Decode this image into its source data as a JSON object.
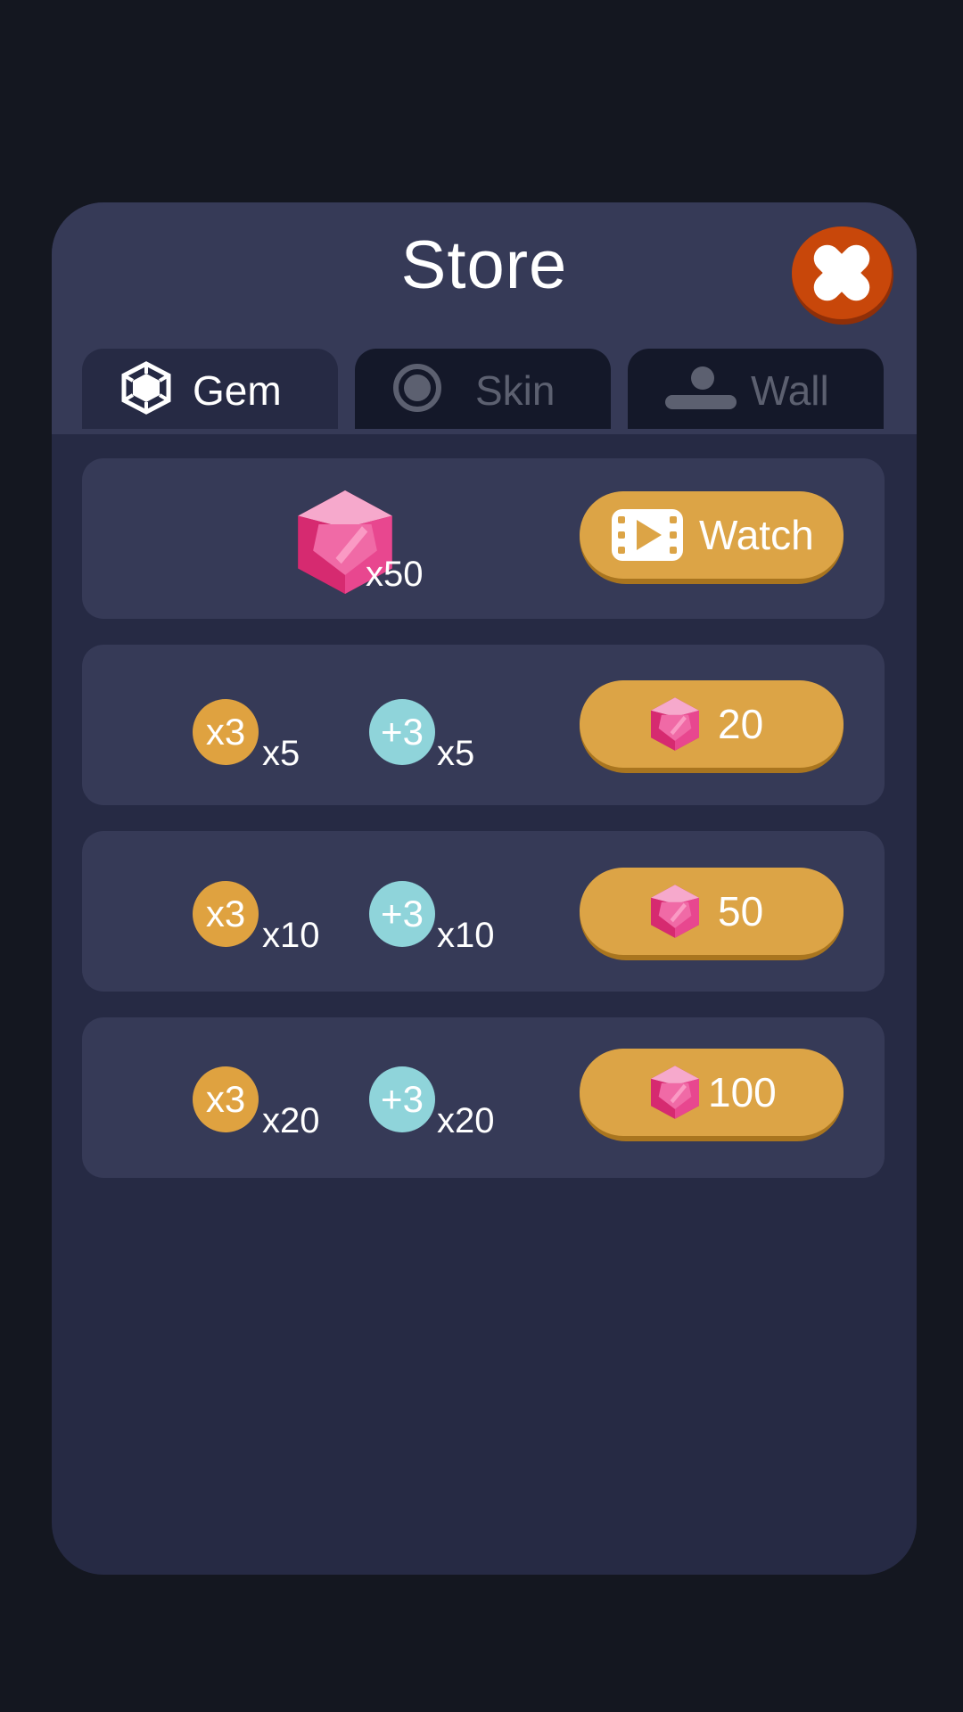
{
  "store": {
    "title": "Store",
    "tabs": [
      {
        "label": "Gem",
        "icon": "hexagon-gem-icon",
        "active": true
      },
      {
        "label": "Skin",
        "icon": "ring-icon",
        "active": false
      },
      {
        "label": "Wall",
        "icon": "person-wall-icon",
        "active": false
      }
    ]
  },
  "offers": [
    {
      "gem_amount": "x50",
      "button_label": "Watch",
      "button_icon": "film-icon"
    },
    {
      "multiplier_label": "x3",
      "multiplier_qty": "x5",
      "bonus_label": "+3",
      "bonus_qty": "x5",
      "price": "20",
      "price_icon": "gem-icon"
    },
    {
      "multiplier_label": "x3",
      "multiplier_qty": "x10",
      "bonus_label": "+3",
      "bonus_qty": "x10",
      "price": "50",
      "price_icon": "gem-icon"
    },
    {
      "multiplier_label": "x3",
      "multiplier_qty": "x20",
      "bonus_label": "+3",
      "bonus_qty": "x20",
      "price": "100",
      "price_icon": "gem-icon"
    }
  ],
  "colors": {
    "background": "#141720",
    "panel": "#262a44",
    "row": "#363a57",
    "button": "#dca446",
    "close": "#c8470a",
    "gem": "#e84a90",
    "coin_gold": "#dfa240",
    "coin_cyan": "#8fd4da"
  }
}
